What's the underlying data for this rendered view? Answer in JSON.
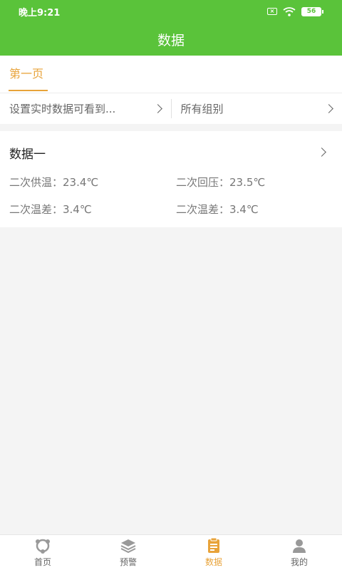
{
  "status": {
    "time": "晚上9:21",
    "battery": "56"
  },
  "header": {
    "title": "数据"
  },
  "tabs": [
    {
      "label": "第一页",
      "active": true
    }
  ],
  "filters": {
    "left": "设置实时数据可看到...",
    "right": "所有组别"
  },
  "card": {
    "title": "数据一",
    "items": [
      "二次供温：23.4℃",
      "二次回压：23.5℃",
      "二次温差：3.4℃",
      "二次温差：3.4℃"
    ]
  },
  "nav": [
    {
      "label": "首页",
      "icon": "home-icon"
    },
    {
      "label": "预警",
      "icon": "layers-icon"
    },
    {
      "label": "数据",
      "icon": "clipboard-icon",
      "active": true
    },
    {
      "label": "我的",
      "icon": "user-icon"
    }
  ],
  "colors": {
    "primary": "#5ac33a",
    "accent": "#e8a33a"
  }
}
